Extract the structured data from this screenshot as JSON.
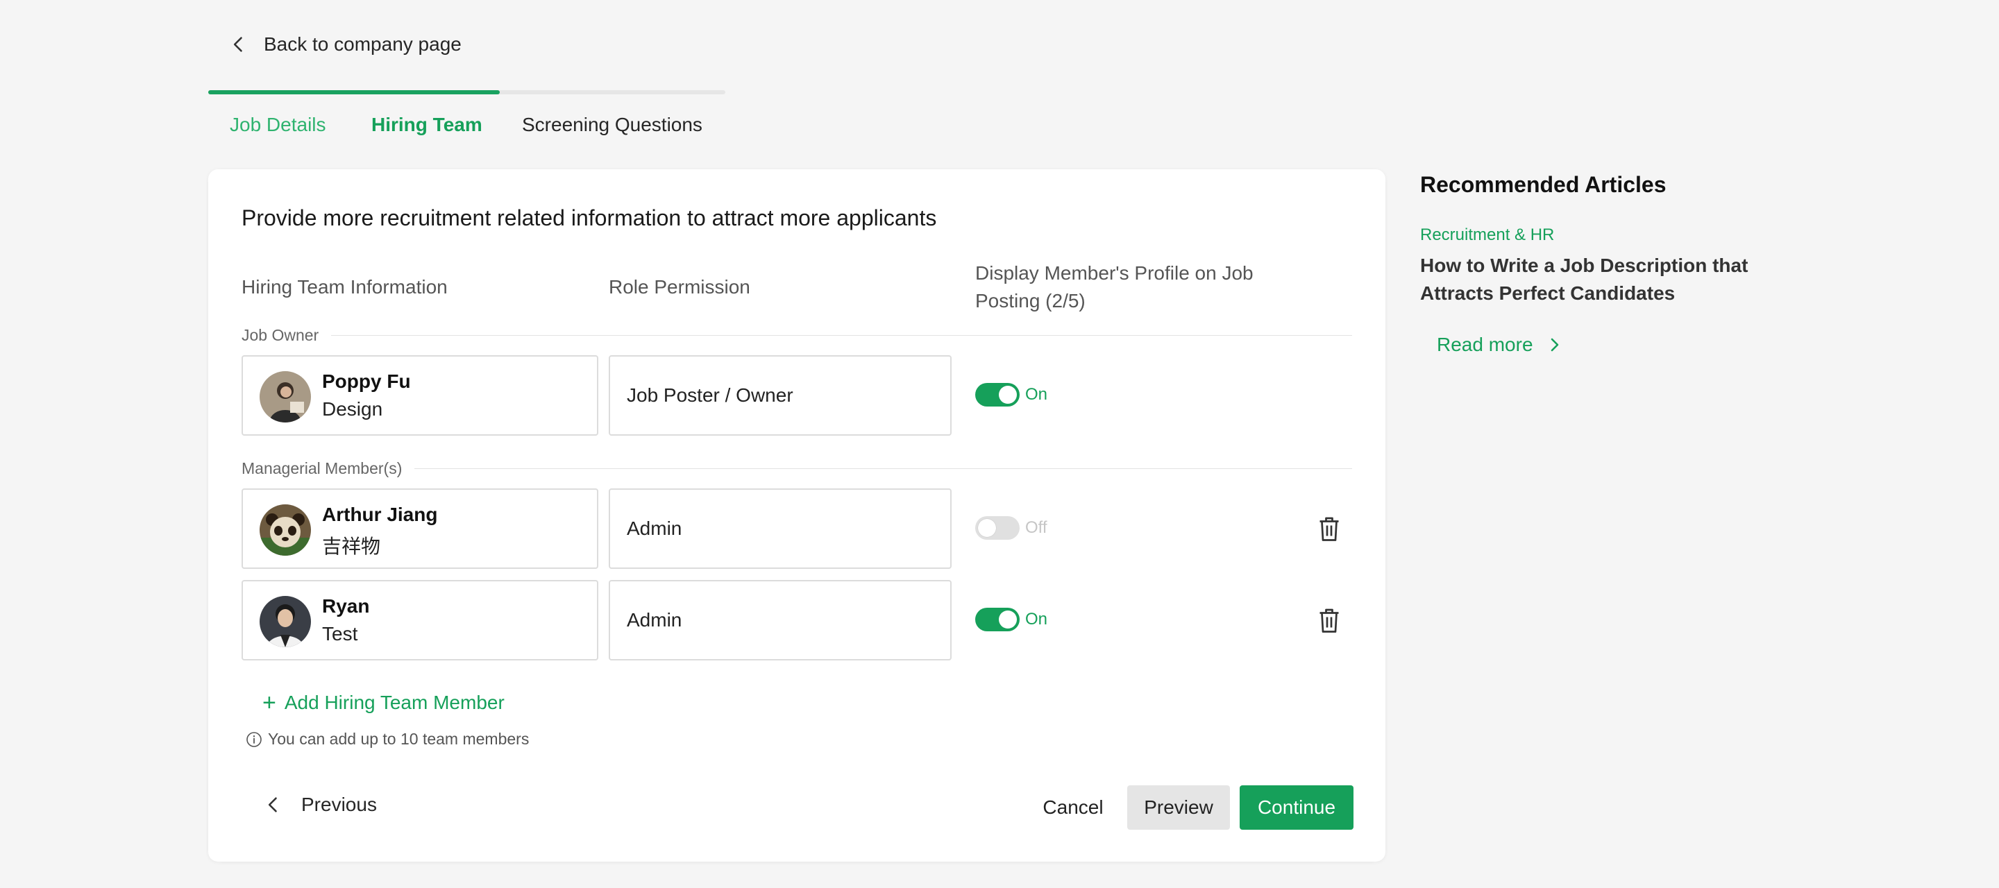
{
  "nav": {
    "back_label": "Back to company page"
  },
  "steps": {
    "tabs": [
      {
        "label": "Job Details",
        "state": "done"
      },
      {
        "label": "Hiring Team",
        "state": "active"
      },
      {
        "label": "Screening Questions",
        "state": "todo"
      }
    ],
    "progress_percent": 56
  },
  "form": {
    "title": "Provide more recruitment related information to attract more applicants",
    "columns": {
      "info": "Hiring Team Information",
      "role": "Role Permission",
      "display": "Display Member's Profile on Job Posting (2/5)"
    },
    "job_owner_label": "Job Owner",
    "managerial_label": "Managerial Member(s)",
    "owner": {
      "name": "Poppy Fu",
      "dept": "Design",
      "role": "Job Poster / Owner",
      "display": true,
      "display_label": "On"
    },
    "members": [
      {
        "name": "Arthur Jiang",
        "dept": "吉祥物",
        "role": "Admin",
        "display": false,
        "display_label": "Off"
      },
      {
        "name": "Ryan",
        "dept": "Test",
        "role": "Admin",
        "display": true,
        "display_label": "On"
      }
    ],
    "add_member_label": "Add Hiring Team Member",
    "hint": "You can add up to 10 team members",
    "buttons": {
      "previous": "Previous",
      "cancel": "Cancel",
      "preview": "Preview",
      "continue": "Continue"
    }
  },
  "aside": {
    "title": "Recommended Articles",
    "category": "Recruitment & HR",
    "article_title": "How to Write a Job Description that Attracts Perfect Candidates",
    "read_more": "Read more"
  },
  "colors": {
    "accent": "#16a05a",
    "toggle_off": "#e0e0e0",
    "background": "#f5f5f5"
  }
}
